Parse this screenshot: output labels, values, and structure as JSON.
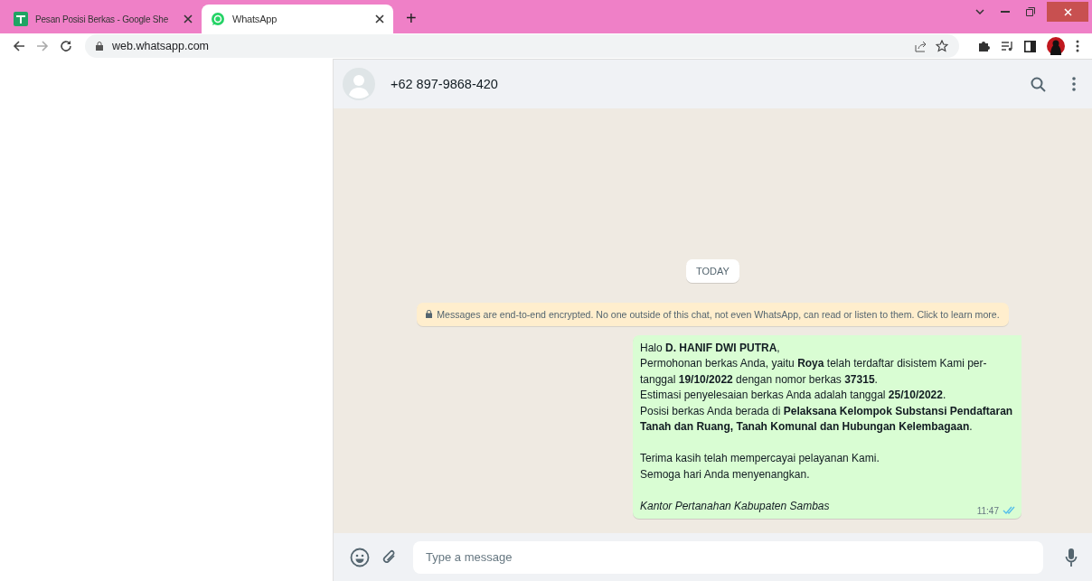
{
  "browser": {
    "tabs": [
      {
        "title": "Pesan Posisi Berkas - Google She",
        "kind": "sheets",
        "selected": false
      },
      {
        "title": "WhatsApp",
        "kind": "whatsapp",
        "selected": true
      }
    ],
    "new_tab": "+",
    "url": "web.whatsapp.com"
  },
  "chat": {
    "contact": "+62 897-9868-420",
    "date_chip": "TODAY",
    "encryption_notice": "Messages are end-to-end encrypted. No one outside of this chat, not even WhatsApp, can read or listen to them. Click to learn more.",
    "messages": [
      {
        "paragraphs": [
          [
            "Halo **D. HANIF DWI PUTRA**,",
            "Permohonan berkas Anda, yaitu **Roya** telah terdaftar disistem Kami per-",
            "tanggal **19/10/2022** dengan nomor berkas **37315**.",
            "Estimasi penyelesaian berkas Anda adalah tanggal **25/10/2022**.",
            "Posisi berkas Anda berada di **Pelaksana Kelompok Substansi Pendaftaran**",
            "**Tanah dan Ruang, Tanah Komunal dan Hubungan Kelembagaan**."
          ],
          [
            "Terima kasih telah mempercayai pelayanan Kami.",
            "Semoga hari Anda menyenangkan."
          ]
        ],
        "signature": "Kantor Pertanahan Kabupaten Sambas",
        "time": "11:47",
        "read": true
      }
    ],
    "composer": {
      "placeholder": "Type a message"
    }
  }
}
